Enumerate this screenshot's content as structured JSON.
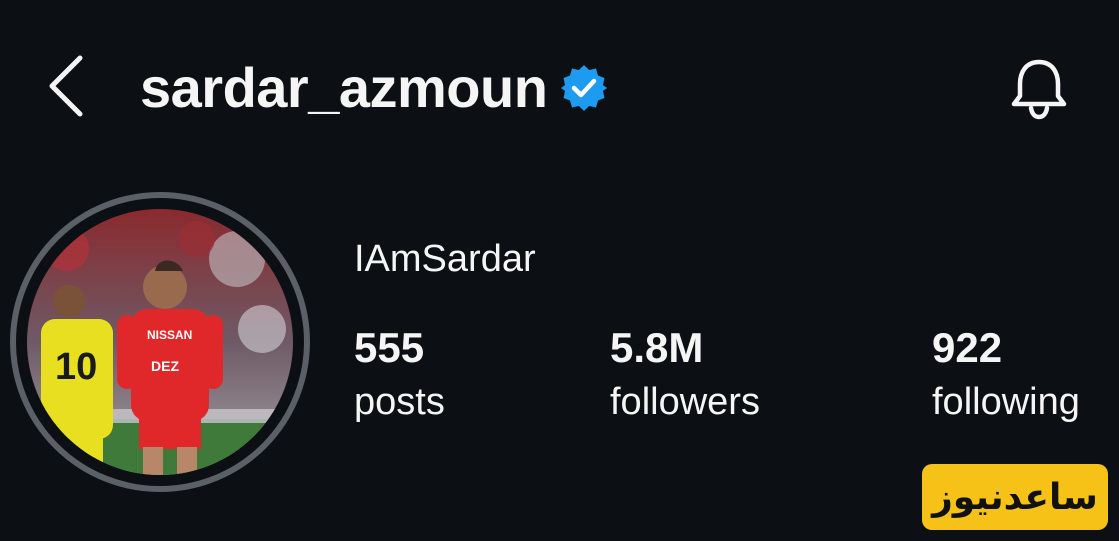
{
  "header": {
    "back_icon": "chevron-left-icon",
    "username": "sardar_azmoun",
    "verified_icon": "verified-badge-icon",
    "verified_color": "#1d9bf0",
    "notification_icon": "bell-icon"
  },
  "profile": {
    "avatar_description": "avatar",
    "display_name": "IAmSardar"
  },
  "stats": [
    {
      "value": "555",
      "label": "posts"
    },
    {
      "value": "5.8M",
      "label": "followers"
    },
    {
      "value": "922",
      "label": "following"
    }
  ],
  "watermark": {
    "text": "ساعدنیوز",
    "background_color": "#f7c217"
  }
}
